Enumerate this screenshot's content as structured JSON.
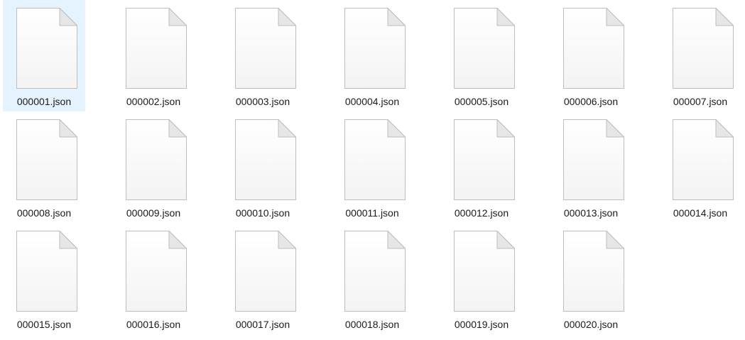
{
  "files": [
    {
      "name": "000001.json",
      "icon": "json-file-icon",
      "selected": true
    },
    {
      "name": "000002.json",
      "icon": "json-file-icon"
    },
    {
      "name": "000003.json",
      "icon": "json-file-icon"
    },
    {
      "name": "000004.json",
      "icon": "json-file-icon"
    },
    {
      "name": "000005.json",
      "icon": "json-file-icon"
    },
    {
      "name": "000006.json",
      "icon": "json-file-icon"
    },
    {
      "name": "000007.json",
      "icon": "json-file-icon"
    },
    {
      "name": "000008.json",
      "icon": "json-file-icon"
    },
    {
      "name": "000009.json",
      "icon": "json-file-icon"
    },
    {
      "name": "000010.json",
      "icon": "json-file-icon"
    },
    {
      "name": "000011.json",
      "icon": "json-file-icon"
    },
    {
      "name": "000012.json",
      "icon": "json-file-icon"
    },
    {
      "name": "000013.json",
      "icon": "json-file-icon"
    },
    {
      "name": "000014.json",
      "icon": "json-file-icon"
    },
    {
      "name": "000015.json",
      "icon": "json-file-icon"
    },
    {
      "name": "000016.json",
      "icon": "json-file-icon"
    },
    {
      "name": "000017.json",
      "icon": "json-file-icon"
    },
    {
      "name": "000018.json",
      "icon": "json-file-icon"
    },
    {
      "name": "000019.json",
      "icon": "json-file-icon"
    },
    {
      "name": "000020.json",
      "icon": "json-file-icon"
    }
  ],
  "colors": {
    "selection": "#e5f3ff",
    "text": "#1a1a1a",
    "page_fill": "#fbfbfb",
    "page_border": "#bdbdbd",
    "fold_fill": "#e6e6e6"
  }
}
